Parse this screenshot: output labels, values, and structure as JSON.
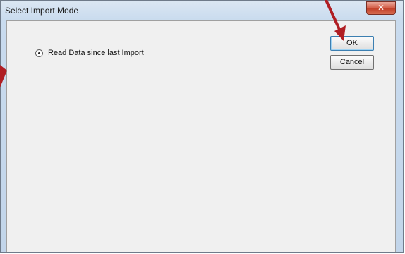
{
  "window": {
    "title": "Select Import Mode",
    "close_glyph": "✕"
  },
  "dialog": {
    "radio_option_label": "Read Data since last Import",
    "radio_option_selected": true,
    "ok_label": "OK",
    "cancel_label": "Cancel"
  },
  "annotations": {
    "arrow_color": "#b01e23",
    "arrow_icon": "pointer-arrow-icon",
    "side_arrow_icon": "side-arrow-icon"
  }
}
